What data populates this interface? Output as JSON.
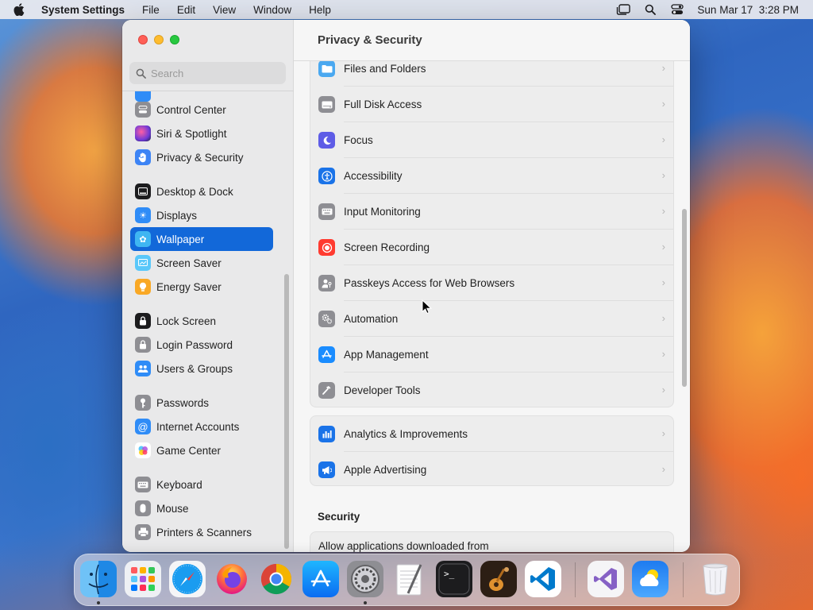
{
  "menubar": {
    "apple_icon": "apple-logo-icon",
    "app_name": "System Settings",
    "menus": [
      "File",
      "Edit",
      "View",
      "Window",
      "Help"
    ],
    "status_icons": [
      "stage-manager-icon",
      "spotlight-search-icon",
      "control-center-icon"
    ],
    "datetime": "Sun Mar 17  3:28 PM"
  },
  "window": {
    "search_placeholder": "Search",
    "sidebar": {
      "items": [
        {
          "label": "Control Center",
          "icon": "control-center-icon",
          "color": "#8e8e93"
        },
        {
          "label": "Siri & Spotlight",
          "icon": "siri-icon",
          "color": "#7a3fd1"
        },
        {
          "label": "Privacy & Security",
          "icon": "hand-icon",
          "color": "#3d84f5"
        },
        {
          "label": "Desktop & Dock",
          "icon": "dock-icon",
          "color": "#1c1c1e"
        },
        {
          "label": "Displays",
          "icon": "sun-icon",
          "color": "#2f8cf7"
        },
        {
          "label": "Wallpaper",
          "icon": "flower-icon",
          "color": "#3fb6f2",
          "selected": true
        },
        {
          "label": "Screen Saver",
          "icon": "screen-saver-icon",
          "color": "#5ac8fa"
        },
        {
          "label": "Energy Saver",
          "icon": "lightbulb-icon",
          "color": "#f9a825"
        },
        {
          "label": "Lock Screen",
          "icon": "lock-icon",
          "color": "#1c1c1e"
        },
        {
          "label": "Login Password",
          "icon": "lock-icon",
          "color": "#8e8e93"
        },
        {
          "label": "Users & Groups",
          "icon": "users-icon",
          "color": "#2f8cf7"
        },
        {
          "label": "Passwords",
          "icon": "key-icon",
          "color": "#8e8e93"
        },
        {
          "label": "Internet Accounts",
          "icon": "at-icon",
          "color": "#2f8cf7"
        },
        {
          "label": "Game Center",
          "icon": "game-center-icon",
          "color": "#ffffff"
        },
        {
          "label": "Keyboard",
          "icon": "keyboard-icon",
          "color": "#8e8e93"
        },
        {
          "label": "Mouse",
          "icon": "mouse-icon",
          "color": "#8e8e93"
        },
        {
          "label": "Printers & Scanners",
          "icon": "printer-icon",
          "color": "#8e8e93"
        }
      ]
    },
    "main": {
      "title": "Privacy & Security",
      "permissions": [
        {
          "label": "Files and Folders",
          "icon": "folder-icon",
          "color": "#4aa8f0"
        },
        {
          "label": "Full Disk Access",
          "icon": "disk-icon",
          "color": "#8e8e93"
        },
        {
          "label": "Focus",
          "icon": "moon-icon",
          "color": "#5e5ce6"
        },
        {
          "label": "Accessibility",
          "icon": "accessibility-icon",
          "color": "#1a73e8"
        },
        {
          "label": "Input Monitoring",
          "icon": "keyboard-icon",
          "color": "#8e8e93"
        },
        {
          "label": "Screen Recording",
          "icon": "record-icon",
          "color": "#ff3b30"
        },
        {
          "label": "Passkeys Access for Web Browsers",
          "icon": "passkey-icon",
          "color": "#8e8e93"
        },
        {
          "label": "Automation",
          "icon": "gears-icon",
          "color": "#8e8e93"
        },
        {
          "label": "App Management",
          "icon": "app-store-icon",
          "color": "#1a8cff"
        },
        {
          "label": "Developer Tools",
          "icon": "hammer-icon",
          "color": "#8e8e93"
        }
      ],
      "analytics": [
        {
          "label": "Analytics & Improvements",
          "icon": "chart-icon",
          "color": "#1a73e8"
        },
        {
          "label": "Apple Advertising",
          "icon": "megaphone-icon",
          "color": "#1a73e8"
        }
      ],
      "security_title": "Security",
      "security_first_row": "Allow applications downloaded from"
    }
  },
  "dock": {
    "apps": [
      {
        "name": "Finder",
        "icon": "finder-icon",
        "running": true
      },
      {
        "name": "Launchpad",
        "icon": "launchpad-icon",
        "running": false
      },
      {
        "name": "Safari",
        "icon": "safari-icon",
        "running": false
      },
      {
        "name": "Firefox",
        "icon": "firefox-icon",
        "running": false
      },
      {
        "name": "Chrome",
        "icon": "chrome-icon",
        "running": false
      },
      {
        "name": "App Store",
        "icon": "app-store-icon",
        "running": false
      },
      {
        "name": "System Settings",
        "icon": "system-settings-icon",
        "running": true
      },
      {
        "name": "TextEdit",
        "icon": "textedit-icon",
        "running": false
      },
      {
        "name": "Terminal",
        "icon": "terminal-icon",
        "running": false
      },
      {
        "name": "GarageBand",
        "icon": "garageband-icon",
        "running": false
      },
      {
        "name": "Visual Studio Code",
        "icon": "vscode-icon",
        "running": false
      },
      {
        "name": "Visual Studio",
        "icon": "visual-studio-icon",
        "running": false
      },
      {
        "name": "Weather",
        "icon": "weather-icon",
        "running": false
      },
      {
        "name": "Trash",
        "icon": "trash-icon",
        "running": false
      }
    ]
  }
}
